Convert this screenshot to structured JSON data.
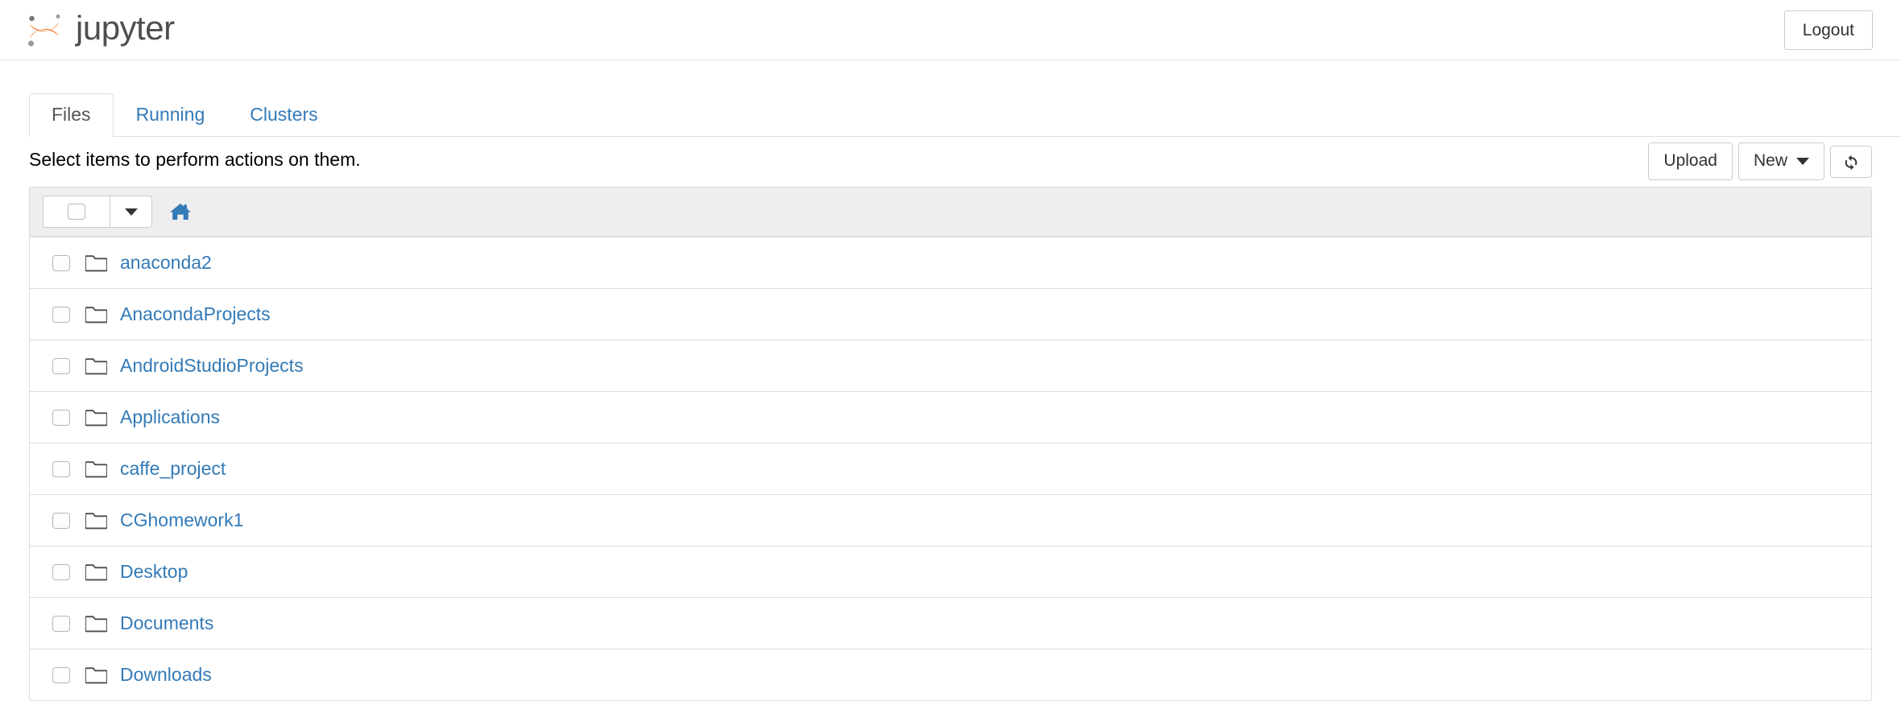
{
  "header": {
    "brand_text": "jupyter",
    "logo_icon": "jupyter-logo-icon",
    "logout_label": "Logout"
  },
  "tabs": [
    {
      "label": "Files",
      "active": true
    },
    {
      "label": "Running",
      "active": false
    },
    {
      "label": "Clusters",
      "active": false
    }
  ],
  "toolbar": {
    "note": "Select items to perform actions on them.",
    "upload_label": "Upload",
    "new_label": "New",
    "new_caret_icon": "chevron-down-icon",
    "refresh_icon": "refresh-icon"
  },
  "list_header": {
    "select_all_checked": false,
    "select_all_caret_icon": "chevron-down-icon",
    "breadcrumb_home_icon": "home-icon",
    "breadcrumb_path": ""
  },
  "colors": {
    "link_blue": "#337ab7",
    "logo_orange": "#f37726",
    "logo_gray": "#767677",
    "panel_border": "#dddddd",
    "header_bg": "#eeeeee"
  },
  "files": [
    {
      "name": "anaconda2",
      "type": "folder",
      "checked": false
    },
    {
      "name": "AnacondaProjects",
      "type": "folder",
      "checked": false
    },
    {
      "name": "AndroidStudioProjects",
      "type": "folder",
      "checked": false
    },
    {
      "name": "Applications",
      "type": "folder",
      "checked": false
    },
    {
      "name": "caffe_project",
      "type": "folder",
      "checked": false
    },
    {
      "name": "CGhomework1",
      "type": "folder",
      "checked": false
    },
    {
      "name": "Desktop",
      "type": "folder",
      "checked": false
    },
    {
      "name": "Documents",
      "type": "folder",
      "checked": false
    },
    {
      "name": "Downloads",
      "type": "folder",
      "checked": false
    }
  ]
}
